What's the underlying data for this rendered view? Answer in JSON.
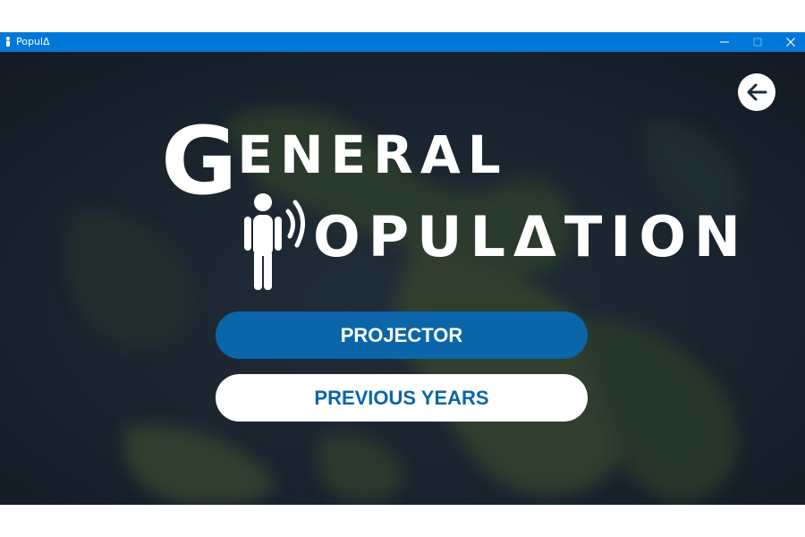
{
  "window": {
    "title": "PopulΔ",
    "icon": "app-person-icon",
    "controls": [
      "minimize-icon",
      "maximize-icon",
      "close-icon"
    ]
  },
  "colors": {
    "titlebar": "#0078d7",
    "primary_button": "#0a66a8",
    "secondary_button_text": "#0a66a8",
    "background": "#1b2431"
  },
  "header": {
    "back_icon": "arrow-left-icon"
  },
  "logo": {
    "line1_initial": "G",
    "line1_rest": "ENERAL",
    "line2_rest": "OPULΔTION",
    "figure_icon": "person-signal-icon"
  },
  "menu": {
    "projector_label": "PROJECTOR",
    "previous_years_label": "PREVIOUS YEARS"
  }
}
